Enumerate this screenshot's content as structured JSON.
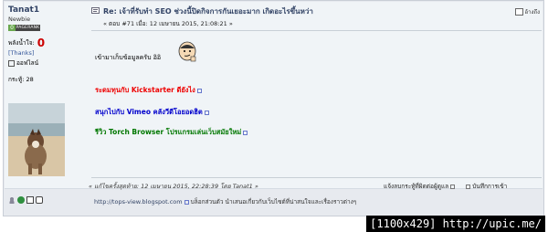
{
  "poster": {
    "username": "Tanat1",
    "rank": "Newbie",
    "pagerank_digit": "0",
    "pagerank_label": "PAGERANK",
    "karma_label": "พลังน้ำใจ:",
    "karma_value": "0",
    "thanks": "[Thanks]",
    "status": "ออฟไลน์",
    "posts": "กระทู้: 28"
  },
  "post": {
    "title": "Re: เจ้าที่รับทำ SEO ช่วงนี้ปิดกิจการกันเยอะมาก เกิดอะไรขึ้นหว่า",
    "meta": "« ตอบ #71 เมื่อ: 12 เมษายน 2015, 21:08:21 »",
    "quote_label": "อ้างถึง",
    "body": "เข้ามาเก็บข้อมูลครับ อิอิ",
    "links": [
      {
        "text": "ระดมทุนกับ Kickstarter ดียังไง",
        "color": "#ee0000"
      },
      {
        "text": "สนุกไปกับ Vimeo คลังวีดีโอยอดฮิต",
        "color": "#0000cc"
      },
      {
        "text": "รีวิว Torch Browser โปรแกรมเล่นเว็บสมัยใหม่",
        "color": "#007700"
      }
    ],
    "edited": "« แก้ไขครั้งสุดท้าย: 12 เมษายน 2015, 22:28:39 โดย Tanat1 »",
    "report_label": "แจ้งลบกระทู้ที่ผิดต่อผู้ดูแล",
    "log_label": "บันทึกการเข้า"
  },
  "signature": {
    "url": "http://tops-view.blogspot.com",
    "text": "บล็อกส่วนตัว นำเสนอเกี่ยวกับเว็บไซต์ที่น่าสนใจและเรื่องราวต่างๆ"
  },
  "watermark": "[1100x429] http://upic.me/"
}
